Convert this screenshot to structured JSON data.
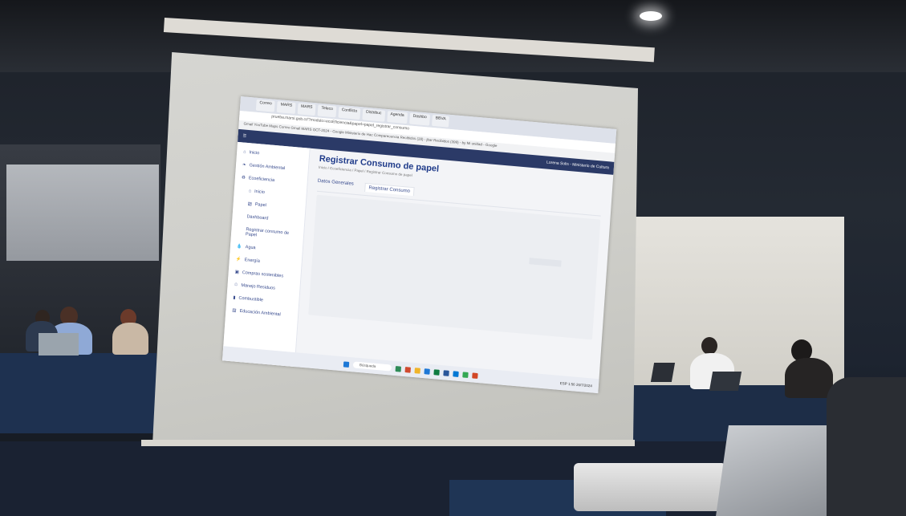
{
  "browser": {
    "tabs": [
      "Correo",
      "MARS",
      "MARS",
      "Teleco",
      "Conflicto",
      "Distribuc",
      "Agenda",
      "Dashbo",
      "BBVA"
    ],
    "url": "prueba.marsi.gob.cr/?modulo=ecoEficiencia&papel=papel_registrar_consumo",
    "bookmarks": "Gmail  YouTube  Maps  Correo Gmail MARS  OCT-2024 - Google  Ministerio de Hac  Comparecencia  Recibidos (28) - jbar  Recibidos (399) - by  Mi unidad - Google"
  },
  "app": {
    "user": "Lorena Solis - Ministerio de Cultura",
    "title": "Registrar Consumo de papel",
    "breadcrumb": "Inicio / Ecoeficiencia / Papel / Registrar Consumo de papel",
    "tabs": [
      "Datos Generales",
      "Registrar Consumo"
    ],
    "sidebar": [
      {
        "label": "Inicio",
        "icon": "home-icon"
      },
      {
        "label": "Gestión Ambiental",
        "icon": "leaf-icon"
      },
      {
        "label": "Ecoeficiencia",
        "icon": "recycle-icon"
      },
      {
        "label": "Inicio",
        "icon": "home-icon",
        "sub": true
      },
      {
        "label": "Papel",
        "icon": "paper-icon",
        "sub": true
      },
      {
        "label": "Dashboard",
        "icon": "",
        "sub": true
      },
      {
        "label": "Registrar consumo de Papel",
        "icon": "",
        "sub": true
      },
      {
        "label": "Agua",
        "icon": "water-icon"
      },
      {
        "label": "Energía",
        "icon": "bolt-icon"
      },
      {
        "label": "Compras sostenibles",
        "icon": "cart-icon"
      },
      {
        "label": "Manejo Residuos",
        "icon": "trash-icon"
      },
      {
        "label": "Combustible",
        "icon": "fuel-icon"
      },
      {
        "label": "Educación Ambiental",
        "icon": "book-icon"
      }
    ]
  },
  "taskbar": {
    "search": "Búsqueda",
    "time": "1:56",
    "date": "26/7/2024",
    "lang": "ESP"
  }
}
